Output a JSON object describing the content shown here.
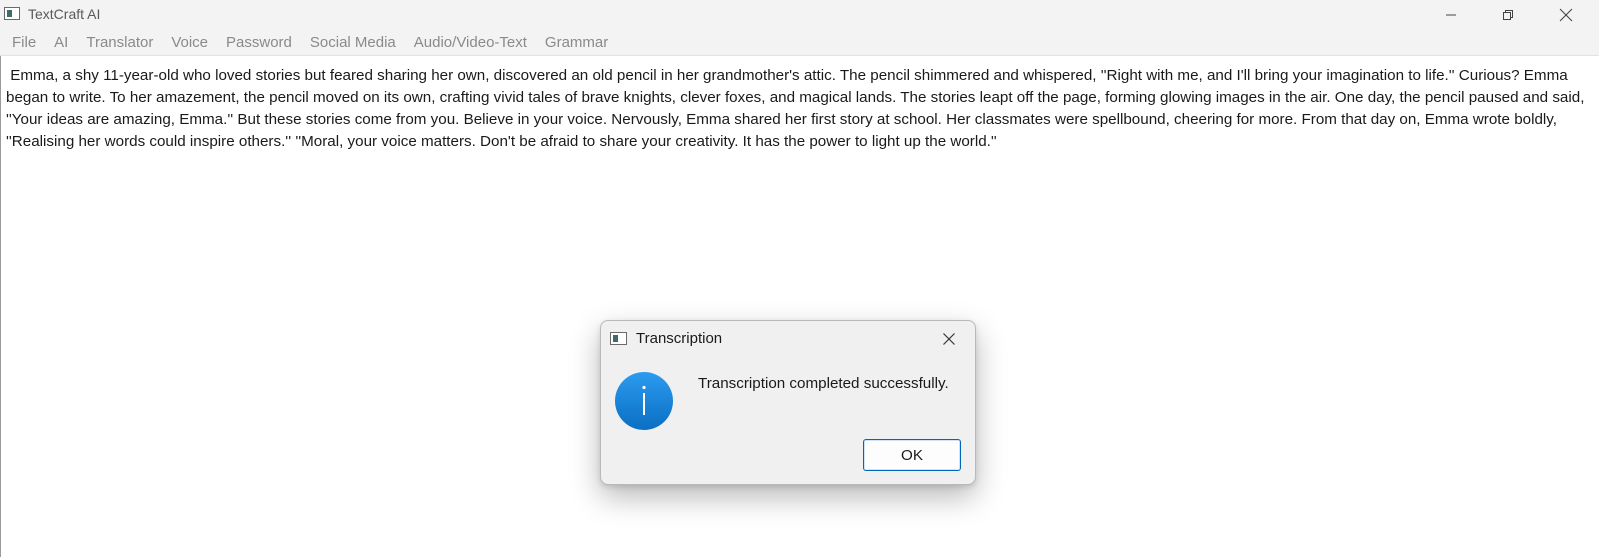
{
  "window": {
    "title": "TextCraft AI"
  },
  "menu": {
    "items": [
      "File",
      "AI",
      "Translator",
      "Voice",
      "Password",
      "Social Media",
      "Audio/Video-Text",
      "Grammar"
    ]
  },
  "editor": {
    "text": " Emma, a shy 11-year-old who loved stories but feared sharing her own, discovered an old pencil in her grandmother's attic. The pencil shimmered and whispered, ''Right with me, and I'll bring your imagination to life.'' Curious? Emma began to write. To her amazement, the pencil moved on its own, crafting vivid tales of brave knights, clever foxes, and magical lands. The stories leapt off the page, forming glowing images in the air. One day, the pencil paused and said, ''Your ideas are amazing, Emma.'' But these stories come from you. Believe in your voice. Nervously, Emma shared her first story at school. Her classmates were spellbound, cheering for more. From that day on, Emma wrote boldly, ''Realising her words could inspire others.'' ''Moral, your voice matters. Don't be afraid to share your creativity. It has the power to light up the world.''"
  },
  "dialog": {
    "title": "Transcription",
    "message": "Transcription completed successfully.",
    "ok_label": "OK",
    "icon": "info-icon"
  },
  "colors": {
    "accent": "#0067c0",
    "info_icon": "#1a86d8",
    "titlebar_bg": "#f3f3f3",
    "menu_text": "#8a8a8a"
  }
}
